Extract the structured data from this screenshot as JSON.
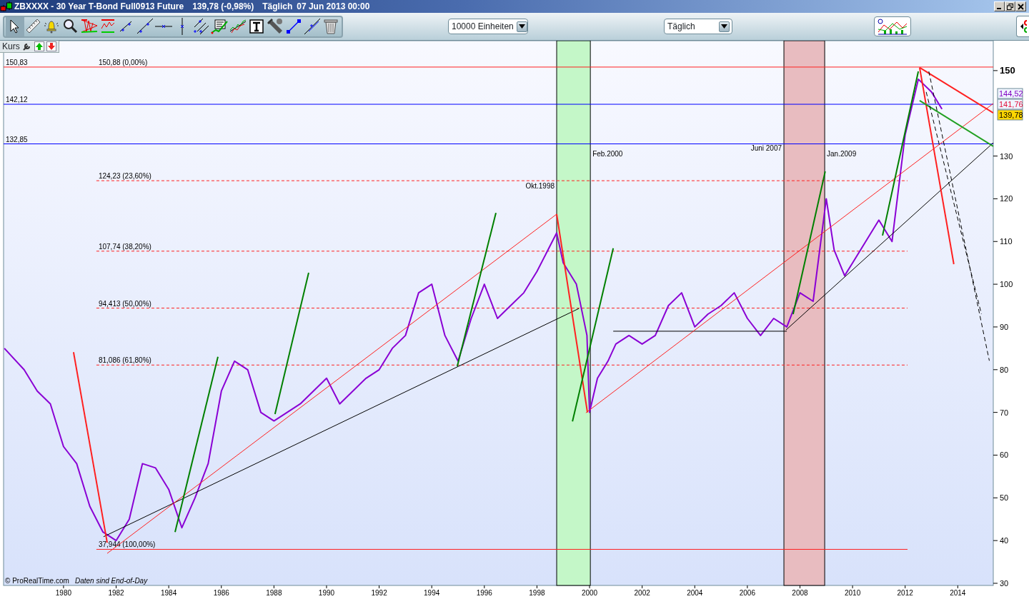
{
  "window": {
    "title": "ZBXXXX - 30 Year T-Bond Full0913 Future",
    "quote": "139,78 (-0,98%)",
    "period": "Täglich",
    "date": "07 Jun 2013 00:00"
  },
  "toolbar": {
    "units_select": {
      "value": "10000 Einheiten"
    },
    "period_select": {
      "value": "Täglich"
    }
  },
  "chart": {
    "price_tags": [
      {
        "value": "144,52",
        "color": "#8000c0",
        "kind": "indicator"
      },
      {
        "value": "141,76",
        "color": "#e0103a",
        "kind": "indicator"
      },
      {
        "value": "139,78",
        "kind": "last"
      }
    ],
    "fib_top_label": "150,88 (0,00%)",
    "event_labels": [
      "Okt.1998",
      "Feb.2000",
      "Juni 2007",
      "Jan.2009"
    ],
    "footer": {
      "copyright": "© ProRealTime.com",
      "note": "Daten sind End-of-Day"
    },
    "chart_data": {
      "type": "line",
      "xlim": [
        1977.72,
        2015.35
      ],
      "ylim": [
        29.5,
        157.0
      ],
      "x": [
        1977.75,
        1978.5,
        1979,
        1979.5,
        1980,
        1980.5,
        1981,
        1981.5,
        1982,
        1982.5,
        1983,
        1983.5,
        1984,
        1984.5,
        1985,
        1985.5,
        1986,
        1986.5,
        1987,
        1987.5,
        1988,
        1988.5,
        1989,
        1989.5,
        1990,
        1990.5,
        1991,
        1991.5,
        1992,
        1992.5,
        1993,
        1993.5,
        1994,
        1994.5,
        1995,
        1995.5,
        1996,
        1996.5,
        1997,
        1997.5,
        1998,
        1998.75,
        1999,
        1999.5,
        1999.9,
        2000,
        2000.3,
        2000.7,
        2001,
        2001.5,
        2002,
        2002.5,
        2003,
        2003.5,
        2004,
        2004.5,
        2005,
        2005.5,
        2006,
        2006.5,
        2007,
        2007.5,
        2008,
        2008.5,
        2009,
        2009.3,
        2009.7,
        2010,
        2010.5,
        2011,
        2011.5,
        2012,
        2012.5,
        2013,
        2013.4
      ],
      "series": [
        {
          "name": "Kurs",
          "color": "#8a00d4",
          "values": [
            85,
            80,
            75,
            72,
            62,
            58,
            48,
            42,
            40,
            45,
            58,
            57,
            52,
            43,
            50,
            58,
            75,
            82,
            80,
            70,
            68,
            70,
            72,
            75,
            78,
            72,
            75,
            78,
            80,
            85,
            88,
            98,
            100,
            88,
            82,
            92,
            100,
            92,
            95,
            98,
            103,
            112,
            105,
            100,
            88,
            70,
            78,
            82,
            86,
            88,
            86,
            88,
            95,
            98,
            90,
            93,
            95,
            98,
            92,
            88,
            92,
            90,
            98,
            96,
            120,
            108,
            102,
            105,
            110,
            115,
            110,
            135,
            148,
            145,
            141
          ]
        }
      ],
      "xticks": [
        1980,
        1982,
        1984,
        1986,
        1988,
        1990,
        1992,
        1994,
        1996,
        1998,
        2000,
        2002,
        2004,
        2006,
        2008,
        2010,
        2012,
        2014
      ],
      "yticks": [
        150,
        130,
        120,
        110,
        100,
        90,
        80,
        70,
        60,
        50,
        40,
        30
      ],
      "bands": [
        {
          "axis": "x",
          "from": 1998.75,
          "to": 2000.03,
          "color": "#c4f7c8"
        },
        {
          "axis": "x",
          "from": 2007.39,
          "to": 2008.94,
          "color": "#e8bcc0"
        }
      ],
      "ref_lines": [
        {
          "axis": "y",
          "value": 150.83,
          "color": "#ff2020",
          "label": "150,83"
        },
        {
          "axis": "y",
          "value": 142.12,
          "color": "#0000ff",
          "label": "142,12"
        },
        {
          "axis": "y",
          "value": 132.85,
          "color": "#0000ff",
          "label": "132,85"
        },
        {
          "axis": "y",
          "value": 124.23,
          "color": "#ff2020",
          "label": "124,23 (23,60%)"
        },
        {
          "axis": "y",
          "value": 107.74,
          "color": "#ff2020",
          "label": "107,74 (38,20%)"
        },
        {
          "axis": "y",
          "value": 94.413,
          "color": "#ff2020",
          "label": "94,413 (50,00%)"
        },
        {
          "axis": "y",
          "value": 81.086,
          "color": "#ff2020",
          "label": "81,086 (61,80%)"
        },
        {
          "axis": "y",
          "value": 37.944,
          "color": "#ff2020",
          "label": "37,944 (100,00%)"
        }
      ]
    }
  }
}
